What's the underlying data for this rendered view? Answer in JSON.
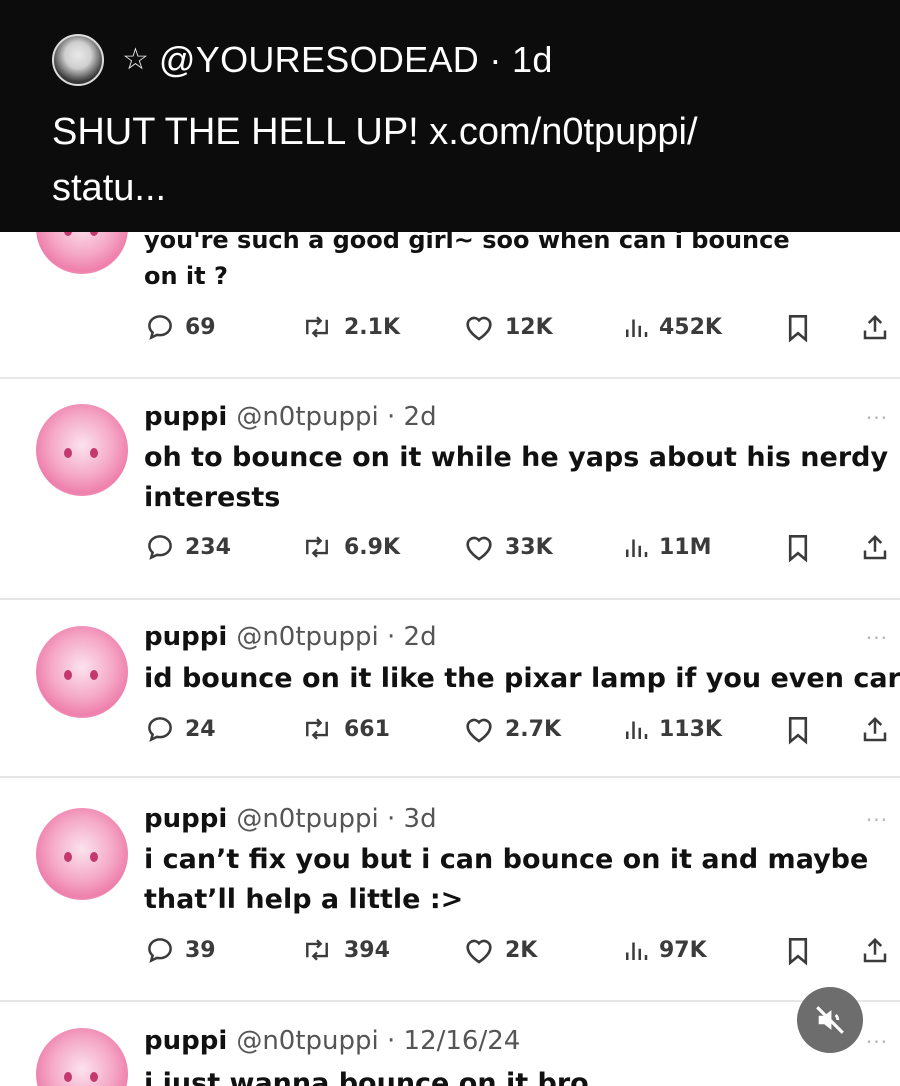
{
  "quote": {
    "star": "☆",
    "handle": "@YOURESODEAD · 1d",
    "text_line1": "SHUT THE HELL UP! x.com/n0tpuppi/",
    "text_line2": "statu..."
  },
  "partial_tweet": {
    "text_line1": "you're such a good girl~ soo when can i bounce",
    "text_line2": "on it ?",
    "stats": {
      "replies": "69",
      "reposts": "2.1K",
      "likes": "12K",
      "views": "452K"
    }
  },
  "tweets": [
    {
      "name": "puppi",
      "handle": "@n0tpuppi · 2d",
      "text": "oh to bounce on it while he yaps about his nerdy interests",
      "stats": {
        "replies": "234",
        "reposts": "6.9K",
        "likes": "33K",
        "views": "11M"
      }
    },
    {
      "name": "puppi",
      "handle": "@n0tpuppi · 2d",
      "text": "id bounce on it like the pixar lamp if you even care",
      "stats": {
        "replies": "24",
        "reposts": "661",
        "likes": "2.7K",
        "views": "113K"
      }
    },
    {
      "name": "puppi",
      "handle": "@n0tpuppi · 3d",
      "text": "i can’t fix you but i can bounce on it and maybe that’ll help a little :>",
      "stats": {
        "replies": "39",
        "reposts": "394",
        "likes": "2K",
        "views": "97K"
      }
    },
    {
      "name": "puppi",
      "handle": "@n0tpuppi · 12/16/24",
      "text": "i just wanna bounce on it bro"
    }
  ],
  "more_label": "···",
  "icons": {
    "reply": "reply-icon",
    "repost": "repost-icon",
    "like": "heart-icon",
    "views": "views-icon",
    "bookmark": "bookmark-icon",
    "share": "share-icon",
    "mute": "mute-icon"
  },
  "colors": {
    "quote_bg": "#0c0c0c",
    "avatar_pink": "#ee7fac",
    "action_gray": "#3b3b3b"
  }
}
